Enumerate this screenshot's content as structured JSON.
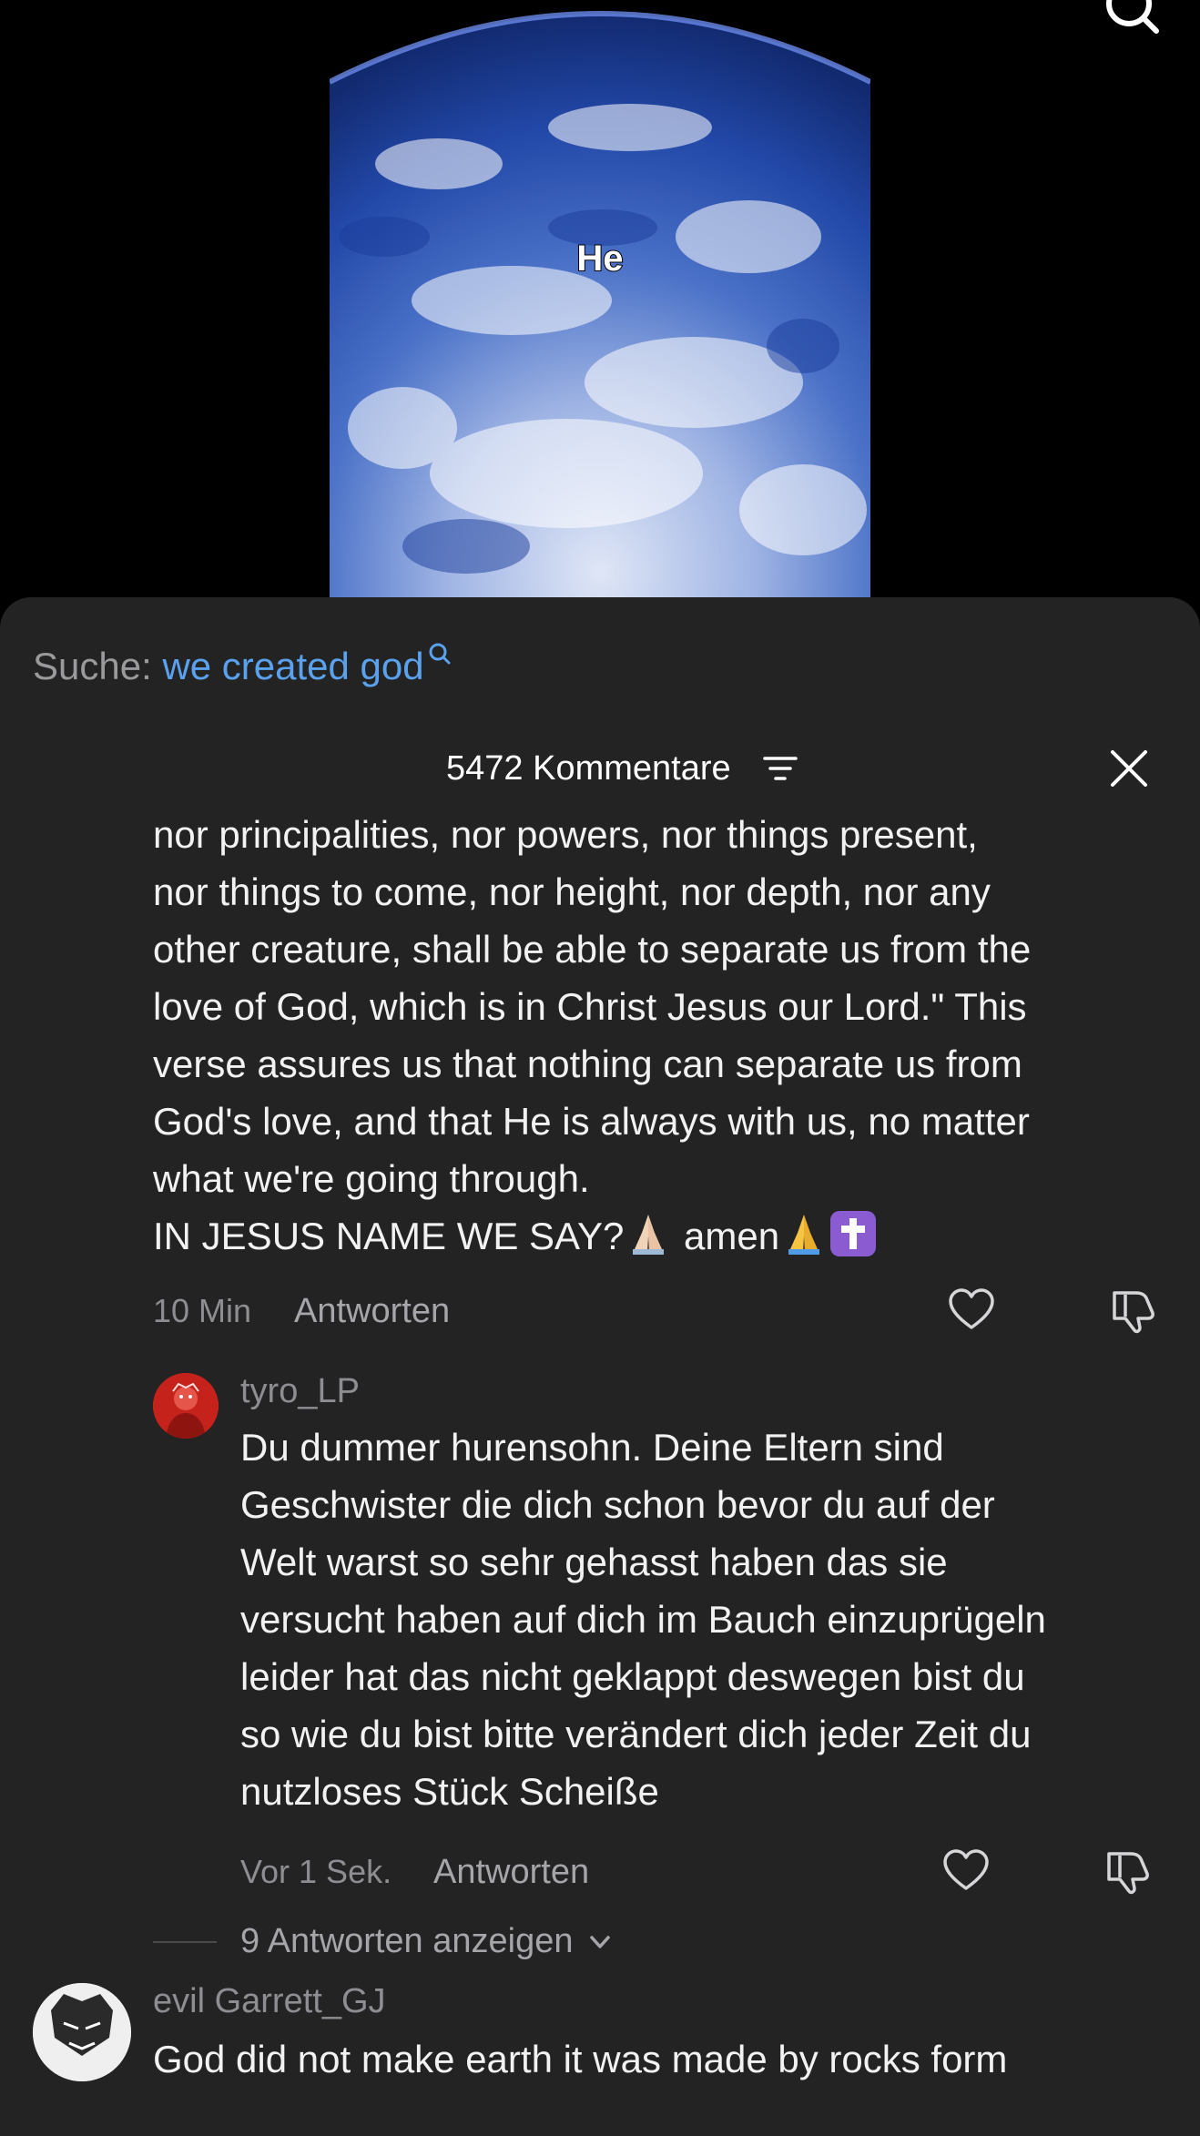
{
  "video": {
    "caption": "He"
  },
  "search": {
    "prefix": "Suche:",
    "term": "we created god"
  },
  "header": {
    "comment_count": "5472 Kommentare"
  },
  "comments": [
    {
      "text_lines": "persuaded, that neither death, nor life, nor angels,\nnor principalities, nor powers, nor things present,\nnor things to come, nor height, nor depth, nor any\nother creature, shall be able to separate us from the\nlove of God, which is in Christ Jesus our Lord.\" This\nverse assures us that nothing can separate us from\nGod's love, and that He is always with us, no matter\nwhat we're going through.",
      "last_line_a": "IN JESUS NAME WE SAY?",
      "last_line_b": " amen",
      "emojis": [
        "folded-hands-light",
        "folded-hands",
        "latin-cross"
      ],
      "time": "10 Min",
      "reply_label": "Antworten"
    },
    {
      "username": "tyro_LP",
      "text": "Du dummer hurensohn. Deine Eltern sind\nGeschwister die dich schon bevor du auf der\nWelt warst so sehr gehasst haben das sie\nversucht haben auf dich im Bauch einzuprügeln\nleider hat das nicht geklappt deswegen bist du\nso wie du bist bitte verändert dich jeder Zeit du\nnutzloses Stück Scheiße",
      "time": "Vor 1 Sek.",
      "reply_label": "Antworten"
    },
    {
      "more_replies": "9 Antworten anzeigen"
    },
    {
      "username": "evil Garrett_GJ",
      "text": "God did not make earth it was made by rocks form"
    }
  ],
  "colors": {
    "sheet_bg": "#232324",
    "search_term": "#5aa2ee",
    "text": "#f2f2f2",
    "muted": "#8e8e92"
  }
}
